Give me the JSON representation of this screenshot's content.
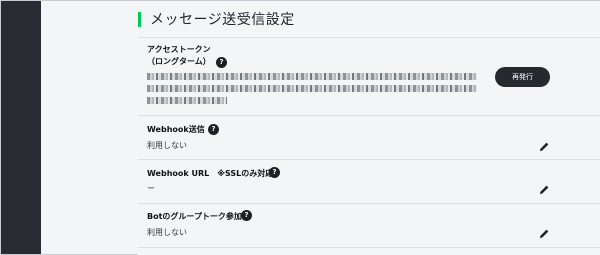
{
  "page": {
    "title": "メッセージ送受信設定",
    "accent_color": "#06c755"
  },
  "access_token": {
    "label_line1": "アクセストークン",
    "label_line2": "（ロングターム）",
    "help_icon": "?",
    "reissue_label": "再発行"
  },
  "webhook_send": {
    "label": "Webhook送信",
    "help_icon": "?",
    "value": "利用しない"
  },
  "webhook_url": {
    "label": "Webhook URL　※SSLのみ対応",
    "help_icon": "?",
    "value": "ー"
  },
  "bot_group": {
    "label": "Botのグループトーク参加",
    "help_icon": "?",
    "value": "利用しない"
  }
}
